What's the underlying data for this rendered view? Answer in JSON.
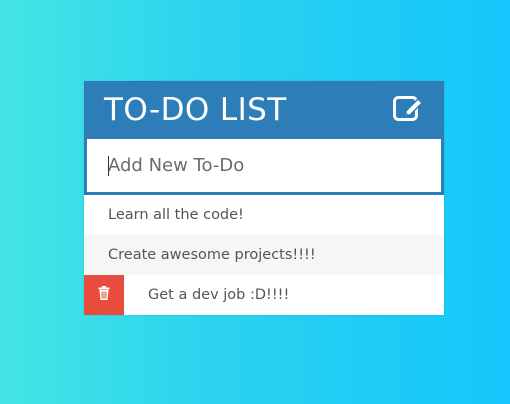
{
  "header": {
    "title": "TO-DO LIST",
    "edit_icon": "pencil-square-icon"
  },
  "input": {
    "placeholder": "Add New To-Do",
    "value": ""
  },
  "todos": [
    {
      "text": "Learn all the code!"
    },
    {
      "text": "Create awesome projects!!!!"
    },
    {
      "text": "Get a dev job :D!!!!",
      "delete_icon": "trash-icon",
      "delete_visible": true
    }
  ],
  "colors": {
    "header_bg": "#2d7db8",
    "delete_bg": "#e74c3c",
    "text": "#555555"
  }
}
